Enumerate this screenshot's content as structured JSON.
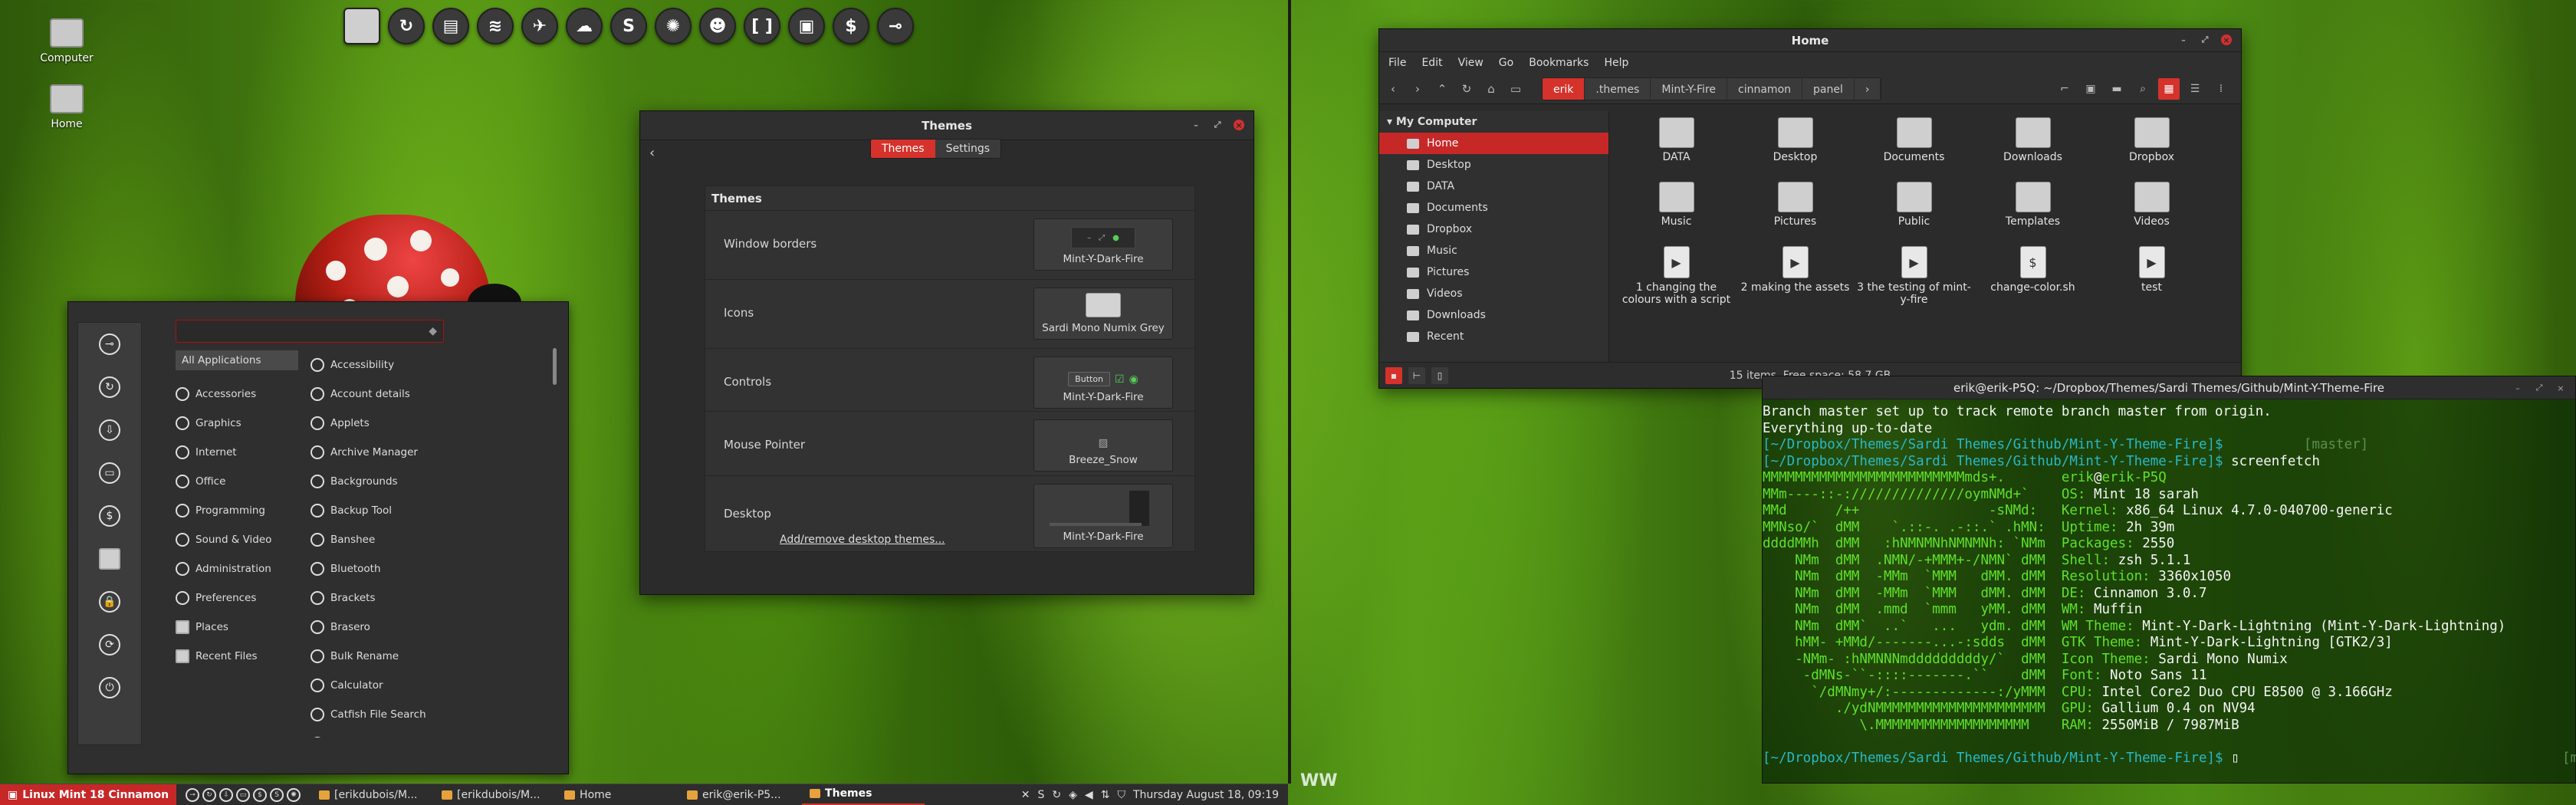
{
  "desktop": {
    "icons": [
      {
        "label": "Computer"
      },
      {
        "label": "Home"
      }
    ]
  },
  "dock": {
    "icons": [
      "folder-icon",
      "update-icon",
      "files-icon",
      "spotify-icon",
      "telegram-icon",
      "cloud-icon",
      "skype-icon",
      "pinwheel-icon",
      "user-icon",
      "bracket-icon",
      "screenshot-icon",
      "terminal-icon",
      "toggle-icon"
    ],
    "glyphs": [
      "",
      "↻",
      "▤",
      "≋",
      "✈",
      "☁",
      "S",
      "✺",
      "☻",
      "[ ]",
      "▣",
      "$",
      "⊸"
    ]
  },
  "menu": {
    "side_glyphs": [
      "⊸",
      "↻",
      "⇩",
      "▭",
      "$",
      "",
      "🔒",
      "⟳",
      "⏻"
    ],
    "categories": [
      "All Applications",
      "Accessories",
      "Graphics",
      "Internet",
      "Office",
      "Programming",
      "Sound & Video",
      "Administration",
      "Preferences",
      "Places",
      "Recent Files"
    ],
    "apps": [
      "Accessibility",
      "Account details",
      "Applets",
      "Archive Manager",
      "Backgrounds",
      "Backup Tool",
      "Banshee",
      "Bluetooth",
      "Brackets",
      "Brasero",
      "Bulk Rename",
      "Calculator",
      "Catfish File Search",
      "Character Map"
    ]
  },
  "themes": {
    "title": "Themes",
    "tabs": [
      "Themes",
      "Settings"
    ],
    "panel_title": "Themes",
    "rows": [
      {
        "label": "Window borders",
        "value": "Mint-Y-Dark-Fire"
      },
      {
        "label": "Icons",
        "value": "Sardi Mono Numix Grey"
      },
      {
        "label": "Controls",
        "value": "Mint-Y-Dark-Fire",
        "button_label": "Button"
      },
      {
        "label": "Mouse Pointer",
        "value": "Breeze_Snow"
      },
      {
        "label": "Desktop",
        "value": "Mint-Y-Dark-Fire"
      }
    ],
    "link": "Add/remove desktop themes..."
  },
  "nemo": {
    "title": "Home",
    "menu": [
      "File",
      "Edit",
      "View",
      "Go",
      "Bookmarks",
      "Help"
    ],
    "breadcrumbs": [
      "erik",
      ".themes",
      "Mint-Y-Fire",
      "cinnamon",
      "panel"
    ],
    "sidebar_header": "My Computer",
    "sidebar": [
      "Home",
      "Desktop",
      "DATA",
      "Documents",
      "Dropbox",
      "Music",
      "Pictures",
      "Videos",
      "Downloads",
      "Recent"
    ],
    "files": [
      {
        "name": "DATA",
        "kind": "folder"
      },
      {
        "name": "Desktop",
        "kind": "folder"
      },
      {
        "name": "Documents",
        "kind": "folder"
      },
      {
        "name": "Downloads",
        "kind": "folder"
      },
      {
        "name": "Dropbox",
        "kind": "folder"
      },
      {
        "name": "Music",
        "kind": "folder"
      },
      {
        "name": "Pictures",
        "kind": "folder"
      },
      {
        "name": "Public",
        "kind": "folder"
      },
      {
        "name": "Templates",
        "kind": "folder"
      },
      {
        "name": "Videos",
        "kind": "folder"
      },
      {
        "name": "1 changing the colours with a script",
        "kind": "video"
      },
      {
        "name": "2 making the assets",
        "kind": "video"
      },
      {
        "name": "3 the testing of mint-y-fire",
        "kind": "video"
      },
      {
        "name": "change-color.sh",
        "kind": "script"
      },
      {
        "name": "test",
        "kind": "video"
      }
    ],
    "status": "15 items, Free space: 58,7 GB"
  },
  "terminal": {
    "title": "erik@erik-P5Q: ~/Dropbox/Themes/Sardi Themes/Github/Mint-Y-Theme-Fire",
    "lines": [
      [
        [
          "Branch master set up to track remote branch master from origin.",
          "wh"
        ]
      ],
      [
        [
          "Everything up-to-date",
          "wh"
        ]
      ],
      [
        [
          "[~/Dropbox/Themes/Sardi Themes/Github/Mint-Y-Theme-Fire]$",
          "cy"
        ],
        [
          "          [master]",
          "dgr"
        ]
      ],
      [
        [
          "[~/Dropbox/Themes/Sardi Themes/Github/Mint-Y-Theme-Fire]$",
          "cy"
        ],
        [
          " screenfetch",
          "wh"
        ]
      ],
      [
        [
          "MMMMMMMMMMMMMMMMMMMMMMMMMmds+.       ",
          "gr"
        ],
        [
          "erik",
          "gr"
        ],
        [
          "@",
          "wh"
        ],
        [
          "erik-P5Q",
          "gr"
        ]
      ],
      [
        [
          "MMm----::-://////////////oymNMd+`    ",
          "gr"
        ],
        [
          "OS: ",
          "gr"
        ],
        [
          "Mint 18 sarah",
          "wh"
        ]
      ],
      [
        [
          "MMd      /++                -sNMd:   ",
          "gr"
        ],
        [
          "Kernel: ",
          "gr"
        ],
        [
          "x86_64 Linux 4.7.0-040700-generic",
          "wh"
        ]
      ],
      [
        [
          "MMNso/`  dMM    `.::-. .-::.` .hMN:  ",
          "gr"
        ],
        [
          "Uptime: ",
          "gr"
        ],
        [
          "2h 39m",
          "wh"
        ]
      ],
      [
        [
          "ddddMMh  dMM   :hNMNMNhNMNMNh: `NMm  ",
          "gr"
        ],
        [
          "Packages: ",
          "gr"
        ],
        [
          "2550",
          "wh"
        ]
      ],
      [
        [
          "    NMm  dMM  .NMN/-+MMM+-/NMN` dMM  ",
          "gr"
        ],
        [
          "Shell: ",
          "gr"
        ],
        [
          "zsh 5.1.1",
          "wh"
        ]
      ],
      [
        [
          "    NMm  dMM  -MMm  `MMM   dMM. dMM  ",
          "gr"
        ],
        [
          "Resolution: ",
          "gr"
        ],
        [
          "3360x1050",
          "wh"
        ]
      ],
      [
        [
          "    NMm  dMM  -MMm  `MMM   dMM. dMM  ",
          "gr"
        ],
        [
          "DE: ",
          "gr"
        ],
        [
          "Cinnamon 3.0.7",
          "wh"
        ]
      ],
      [
        [
          "    NMm  dMM  .mmd  `mmm   yMM. dMM  ",
          "gr"
        ],
        [
          "WM: ",
          "gr"
        ],
        [
          "Muffin",
          "wh"
        ]
      ],
      [
        [
          "    NMm  dMM`  ..`   ...   ydm. dMM  ",
          "gr"
        ],
        [
          "WM Theme: ",
          "gr"
        ],
        [
          "Mint-Y-Dark-Lightning (Mint-Y-Dark-Lightning)",
          "wh"
        ]
      ],
      [
        [
          "    hMM- +MMd/-------...-:sdds  dMM  ",
          "gr"
        ],
        [
          "GTK Theme: ",
          "gr"
        ],
        [
          "Mint-Y-Dark-Lightning [GTK2/3]",
          "wh"
        ]
      ],
      [
        [
          "    -NMm- :hNMNNNmdddddddddy/`  dMM  ",
          "gr"
        ],
        [
          "Icon Theme: ",
          "gr"
        ],
        [
          "Sardi Mono Numix",
          "wh"
        ]
      ],
      [
        [
          "     -dMNs-``-::::-------.``    dMM  ",
          "gr"
        ],
        [
          "Font: ",
          "gr"
        ],
        [
          "Noto Sans 11",
          "wh"
        ]
      ],
      [
        [
          "      `/dMNmy+/:-------------:/yMMM  ",
          "gr"
        ],
        [
          "CPU: ",
          "gr"
        ],
        [
          "Intel Core2 Duo CPU E8500 @ 3.166GHz",
          "wh"
        ]
      ],
      [
        [
          "         ./ydNMMMMMMMMMMMMMMMMMMMMM  ",
          "gr"
        ],
        [
          "GPU: ",
          "gr"
        ],
        [
          "Gallium 0.4 on NV94",
          "wh"
        ]
      ],
      [
        [
          "            \\.MMMMMMMMMMMMMMMMMMM    ",
          "gr"
        ],
        [
          "RAM: ",
          "gr"
        ],
        [
          "2550MiB / 7987MiB",
          "wh"
        ]
      ],
      [
        [
          " ",
          "wh"
        ]
      ],
      [
        [
          "[~/Dropbox/Themes/Sardi Themes/Github/Mint-Y-Theme-Fire]$",
          "cy"
        ],
        [
          " ▯",
          "wh"
        ],
        [
          "                                        [master]",
          "dgr"
        ]
      ]
    ]
  },
  "taskbar": {
    "menu_label": "Linux Mint 18 Cinnamon",
    "windows": [
      "[erikdubois/M...",
      "[erikdubois/M...",
      "Home",
      "erik@erik-P5...",
      "Themes"
    ],
    "clock": "Thursday August 18, 09:19"
  },
  "workspace_badge": "WW"
}
